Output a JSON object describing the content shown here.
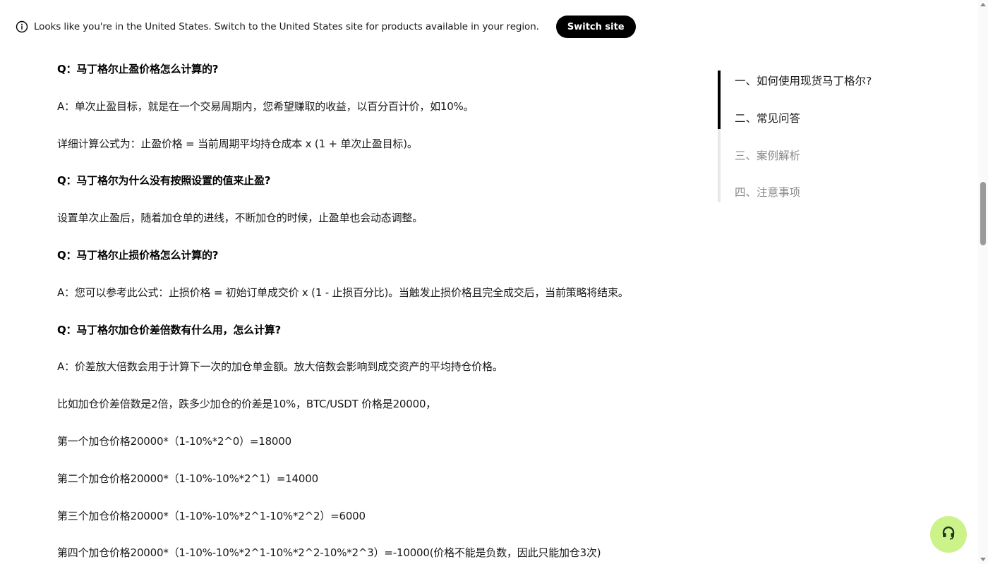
{
  "banner": {
    "text": "Looks like you're in the United States. Switch to the United States site for products available in your region.",
    "button_label": "Switch site",
    "icon": "info-icon"
  },
  "article": {
    "paragraphs": [
      {
        "type": "q",
        "text": "Q：马丁格尔止盈价格怎么计算的?"
      },
      {
        "type": "a",
        "text": "A：单次止盈目标，就是在一个交易周期内，您希望赚取的收益，以百分百计价，如10%。"
      },
      {
        "type": "a",
        "text": "详细计算公式为：止盈价格 = 当前周期平均持仓成本 x (1 + 单次止盈目标)。"
      },
      {
        "type": "q",
        "text": "Q：马丁格尔为什么没有按照设置的值来止盈?"
      },
      {
        "type": "a",
        "text": "设置单次止盈后，随着加仓单的进线，不断加仓的时候，止盈单也会动态调整。"
      },
      {
        "type": "q",
        "text": "Q：马丁格尔止损价格怎么计算的?"
      },
      {
        "type": "a",
        "text": "A：您可以参考此公式：止损价格 = 初始订单成交价 x (1 - 止损百分比)。当触发止损价格且完全成交后，当前策略将结束。"
      },
      {
        "type": "q",
        "text": "Q：马丁格尔加仓价差倍数有什么用，怎么计算?"
      },
      {
        "type": "a",
        "text": "A：价差放大倍数会用于计算下一次的加仓单金额。放大倍数会影响到成交资产的平均持仓价格。"
      },
      {
        "type": "a",
        "text": "比如加仓价差倍数是2倍，跌多少加仓的价差是10%，BTC/USDT 价格是20000，"
      },
      {
        "type": "a",
        "text": "第一个加仓价格20000*（1-10%*2^0）=18000"
      },
      {
        "type": "a",
        "text": "第二个加仓价格20000*（1-10%-10%*2^1）=14000"
      },
      {
        "type": "a",
        "text": "第三个加仓价格20000*（1-10%-10%*2^1-10%*2^2）=6000"
      },
      {
        "type": "a",
        "text": "第四个加仓价格20000*（1-10%-10%*2^1-10%*2^2-10%*2^3）=-10000(价格不能是负数，因此只能加仓3次)"
      }
    ]
  },
  "toc": {
    "items": [
      {
        "label": "一、如何使用现货马丁格尔?",
        "state": "read"
      },
      {
        "label": "二、常见问答",
        "state": "active"
      },
      {
        "label": "三、案例解析",
        "state": "unread"
      },
      {
        "label": "四、注意事项",
        "state": "unread"
      }
    ]
  },
  "support": {
    "icon": "headset-icon",
    "color": "#ccf28a"
  }
}
